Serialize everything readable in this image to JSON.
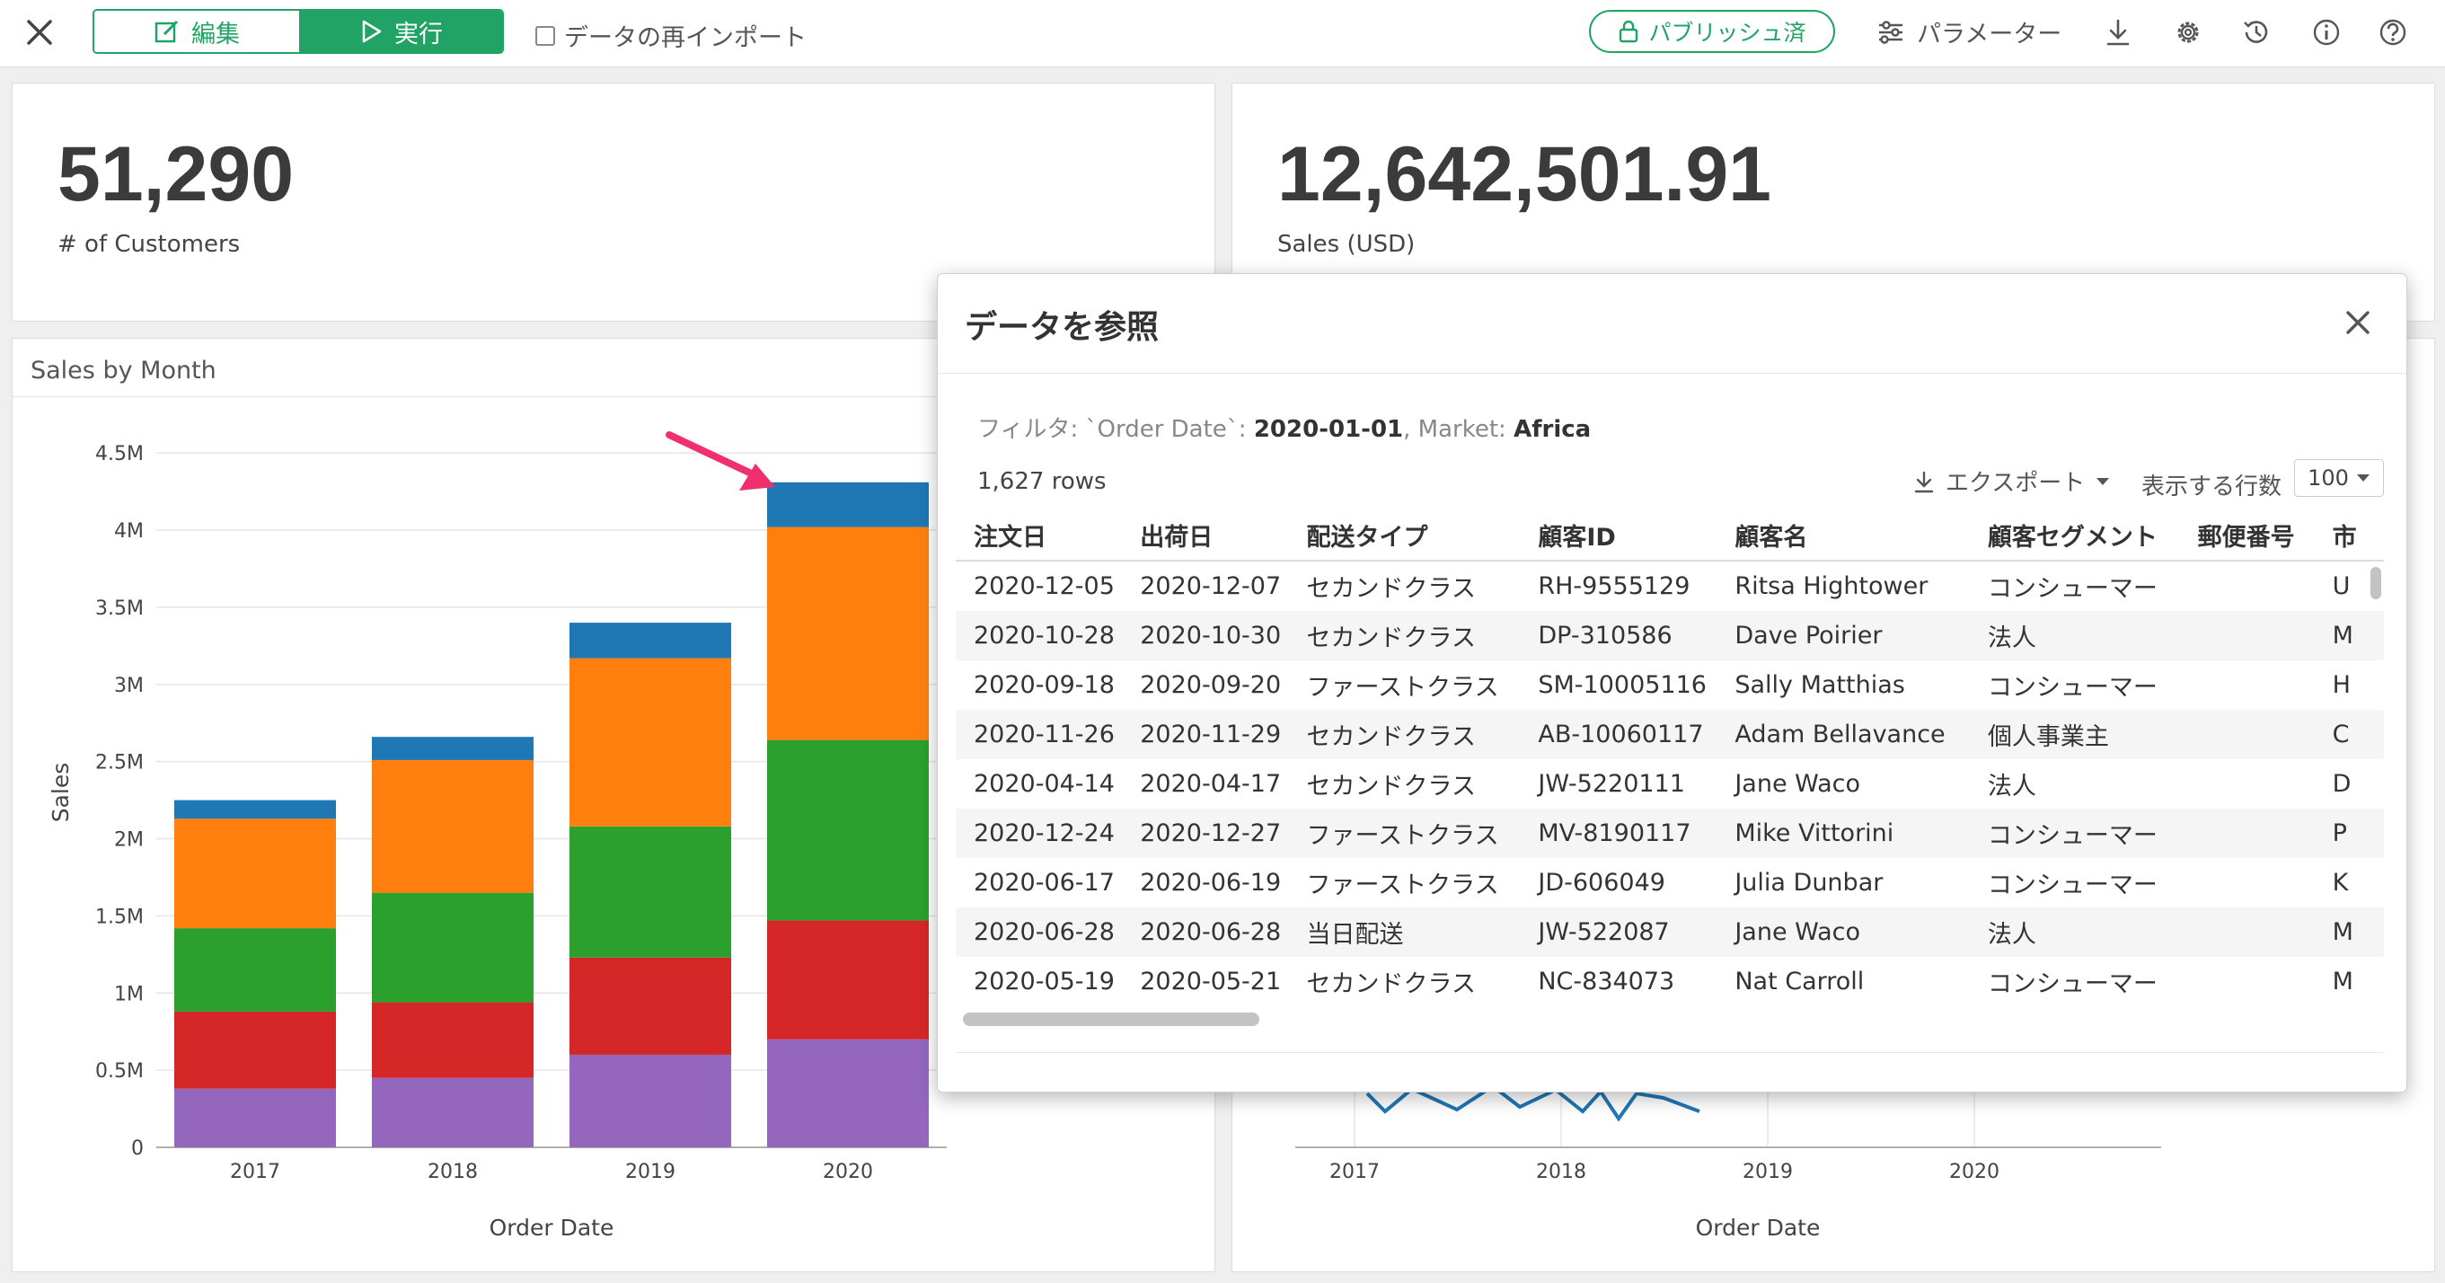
{
  "toolbar": {
    "edit_label": "編集",
    "run_label": "実行",
    "reimport_label": "データの再インポート",
    "published_label": "パブリッシュ済",
    "parameters_label": "パラメーター"
  },
  "kpi": {
    "customers_value": "51,290",
    "customers_label": "# of Customers",
    "sales_value": "12,642,501.91",
    "sales_label": "Sales (USD)"
  },
  "sales_by_month": {
    "title": "Sales by Month"
  },
  "chart_data": [
    {
      "type": "bar",
      "stacked": true,
      "title": "Sales by Month",
      "xlabel": "Order Date",
      "ylabel": "Sales",
      "categories": [
        "2017",
        "2018",
        "2019",
        "2020"
      ],
      "y_ticks": [
        "0",
        "0.5M",
        "1M",
        "1.5M",
        "2M",
        "2.5M",
        "3M",
        "3.5M",
        "4M",
        "4.5M"
      ],
      "ylim": [
        0,
        4600000
      ],
      "grid": true,
      "series": [
        {
          "color": "#9467bd",
          "values": [
            380000,
            450000,
            600000,
            700000
          ]
        },
        {
          "color": "#d62728",
          "values": [
            500000,
            490000,
            630000,
            770000
          ]
        },
        {
          "color": "#2ca02c",
          "values": [
            540000,
            710000,
            850000,
            1170000
          ]
        },
        {
          "color": "#ff7f0e",
          "values": [
            710000,
            860000,
            1090000,
            1380000
          ]
        },
        {
          "color": "#1f77b4",
          "values": [
            120000,
            150000,
            230000,
            290000
          ]
        }
      ]
    },
    {
      "type": "line",
      "xlabel": "Order Date",
      "x_ticks": [
        "2017",
        "2018",
        "2019",
        "2020"
      ],
      "color": "#1f77b4"
    }
  ],
  "modal": {
    "title": "データを参照",
    "filter_prefix": "フィルタ:  `Order Date`: ",
    "filter_date": "2020-01-01",
    "filter_mid": ", Market: ",
    "filter_market": "Africa",
    "rows_count": "1,627 rows",
    "export_label": "エクスポート",
    "show_rows_label": "表示する行数",
    "rows_per_page": "100",
    "columns": [
      "注文日",
      "出荷日",
      "配送タイプ",
      "顧客ID",
      "顧客名",
      "顧客セグメント",
      "郵便番号",
      "市"
    ],
    "rows": [
      [
        "2020-12-05",
        "2020-12-07",
        "セカンドクラス",
        "RH-9555129",
        "Ritsa Hightower",
        "コンシューマー",
        "",
        "U"
      ],
      [
        "2020-10-28",
        "2020-10-30",
        "セカンドクラス",
        "DP-310586",
        "Dave Poirier",
        "法人",
        "",
        "M"
      ],
      [
        "2020-09-18",
        "2020-09-20",
        "ファーストクラス",
        "SM-10005116",
        "Sally Matthias",
        "コンシューマー",
        "",
        "H"
      ],
      [
        "2020-11-26",
        "2020-11-29",
        "セカンドクラス",
        "AB-10060117",
        "Adam Bellavance",
        "個人事業主",
        "",
        "C"
      ],
      [
        "2020-04-14",
        "2020-04-17",
        "セカンドクラス",
        "JW-5220111",
        "Jane Waco",
        "法人",
        "",
        "D"
      ],
      [
        "2020-12-24",
        "2020-12-27",
        "ファーストクラス",
        "MV-8190117",
        "Mike Vittorini",
        "コンシューマー",
        "",
        "P"
      ],
      [
        "2020-06-17",
        "2020-06-19",
        "ファーストクラス",
        "JD-606049",
        "Julia Dunbar",
        "コンシューマー",
        "",
        "K"
      ],
      [
        "2020-06-28",
        "2020-06-28",
        "当日配送",
        "JW-522087",
        "Jane Waco",
        "法人",
        "",
        "M"
      ],
      [
        "2020-05-19",
        "2020-05-21",
        "セカンドクラス",
        "NC-834073",
        "Nat Carroll",
        "コンシューマー",
        "",
        "M"
      ]
    ]
  }
}
